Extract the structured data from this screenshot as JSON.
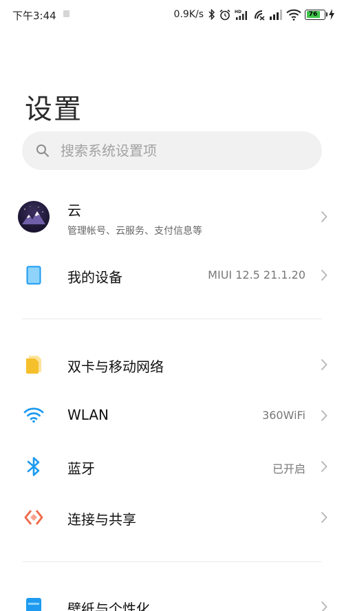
{
  "status_bar": {
    "time": "下午3:44",
    "network_speed": "0.9K/s",
    "battery_level": "76",
    "icons": [
      "bluetooth-icon",
      "alarm-icon",
      "hd-signal-icon",
      "no-sim-icon",
      "signal-icon",
      "wifi-icon",
      "battery-icon",
      "charging-icon"
    ]
  },
  "page": {
    "title": "设置"
  },
  "search": {
    "placeholder": "搜索系统设置项"
  },
  "items": {
    "cloud": {
      "label": "云",
      "subtitle": "管理帐号、云服务、支付信息等"
    },
    "device": {
      "label": "我的设备",
      "value": "MIUI 12.5 21.1.20"
    },
    "sim": {
      "label": "双卡与移动网络"
    },
    "wlan": {
      "label": "WLAN",
      "value": "360WiFi"
    },
    "bluetooth": {
      "label": "蓝牙",
      "value": "已开启"
    },
    "sharing": {
      "label": "连接与共享"
    },
    "wallpaper": {
      "label": "壁纸与个性化"
    }
  },
  "colors": {
    "accent_blue": "#1e9bf0",
    "sim_yellow": "#f6c02c",
    "share_orange": "#f06b4a",
    "battery_green": "#3fc54a"
  }
}
